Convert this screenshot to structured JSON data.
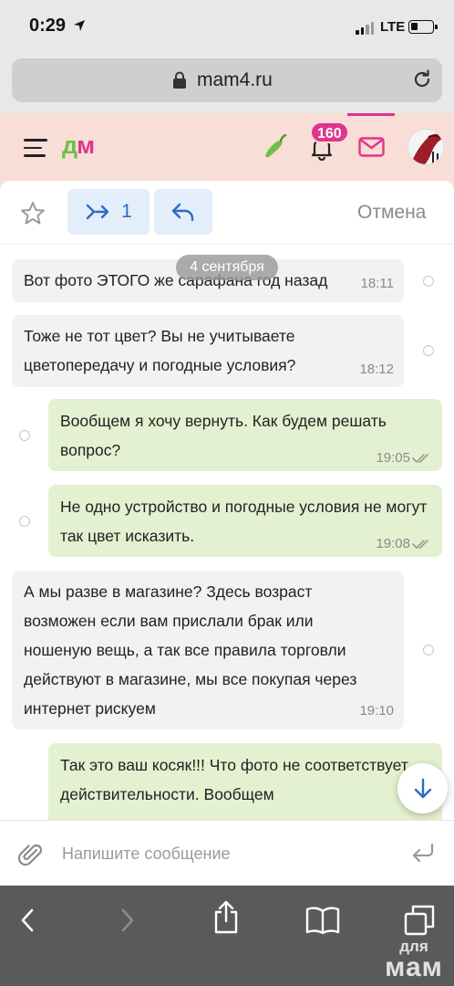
{
  "status_bar": {
    "time": "0:29",
    "network": "LTE"
  },
  "browser": {
    "url": "mam4.ru"
  },
  "site_header": {
    "logo_d": "д",
    "logo_m": "м",
    "notification_count": "160"
  },
  "action_bar": {
    "forward_count": "1",
    "cancel_label": "Отмена"
  },
  "chat": {
    "date_separator": "4 сентября",
    "messages": [
      {
        "direction": "incoming",
        "text": "Вот фото ЭТОГО же сарафана год назад",
        "time": "18:11"
      },
      {
        "direction": "incoming",
        "text": "Тоже не тот цвет? Вы не учитываете цветопередачу и погодные условия?",
        "time": "18:12"
      },
      {
        "direction": "outgoing",
        "text": "Вообщем я  хочу вернуть. Как будем решать вопрос?",
        "time": "19:05",
        "status": "read"
      },
      {
        "direction": "outgoing",
        "text": "Не одно устройство и погодные условия не могут так цвет исказить.",
        "time": "19:08",
        "status": "read"
      },
      {
        "direction": "incoming",
        "text": "А мы разве в магазине? Здесь возраст возможен если вам прислали брак или ношеную вещь, а так все правила торговли действуют в магазине, мы все покупая через интернет рискуем",
        "time": "19:10"
      },
      {
        "direction": "outgoing",
        "text": "Так это ваш косяк!!! Что фото не соответствует действительности. Вообщем",
        "time": ""
      }
    ]
  },
  "composer": {
    "placeholder": "Напишите сообщение"
  },
  "watermark": {
    "line1": "для",
    "line2": "мам"
  },
  "colors": {
    "accent_pink": "#e0358a",
    "logo_green": "#6cc144",
    "header_bg": "#f9ddd7",
    "outgoing_bubble": "#e3f1d0",
    "incoming_bubble": "#f2f2f2",
    "link_blue": "#2a6cc2"
  },
  "icons": [
    "location-arrow-icon",
    "signal-icon",
    "battery-icon",
    "lock-icon",
    "reload-icon",
    "menu-icon",
    "pepper-icon",
    "bell-icon",
    "mail-icon",
    "star-icon",
    "forward-icon",
    "reply-icon",
    "read-check-icon",
    "arrow-down-icon",
    "paperclip-icon",
    "send-icon",
    "back-icon",
    "forward-nav-icon",
    "share-icon",
    "bookmarks-icon",
    "tabs-icon"
  ]
}
